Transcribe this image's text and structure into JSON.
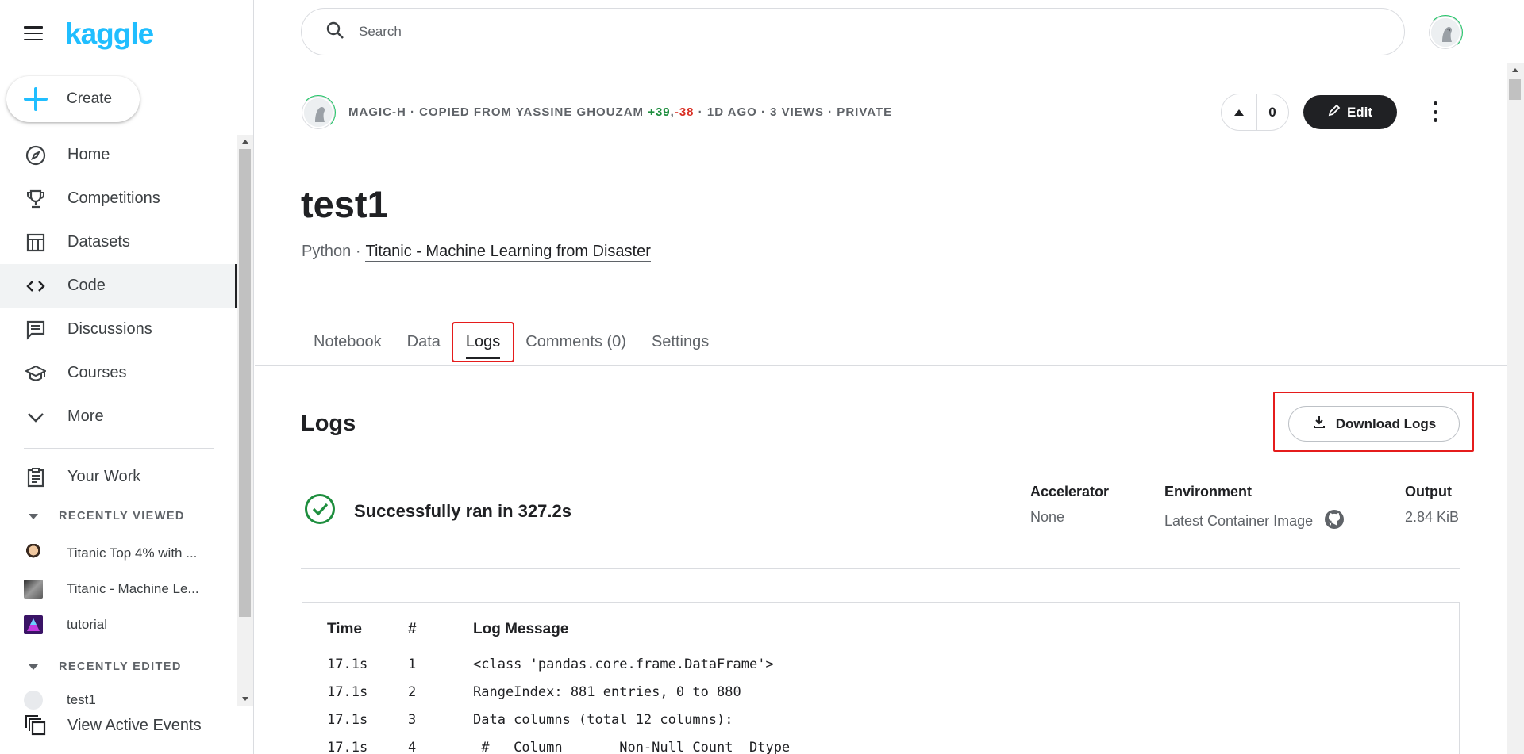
{
  "brand": {
    "logo_text": "kaggle",
    "accent": "#20beff"
  },
  "sidebar": {
    "create_label": "Create",
    "nav": [
      {
        "label": "Home",
        "icon": "compass-icon"
      },
      {
        "label": "Competitions",
        "icon": "trophy-icon"
      },
      {
        "label": "Datasets",
        "icon": "table-icon"
      },
      {
        "label": "Code",
        "icon": "code-icon",
        "active": true
      },
      {
        "label": "Discussions",
        "icon": "comments-icon"
      },
      {
        "label": "Courses",
        "icon": "school-icon"
      },
      {
        "label": "More",
        "icon": "chevron-down-icon"
      }
    ],
    "your_work": "Your Work",
    "recently_viewed_title": "RECENTLY VIEWED",
    "recently_viewed": [
      {
        "label": "Titanic Top 4% with ..."
      },
      {
        "label": "Titanic - Machine Le..."
      },
      {
        "label": "tutorial"
      }
    ],
    "recently_edited_title": "RECENTLY EDITED",
    "recently_edited": [
      {
        "label": "test1"
      }
    ],
    "view_active_events": "View Active Events"
  },
  "search": {
    "placeholder": "Search"
  },
  "notebook": {
    "meta": {
      "author": "MAGIC-H",
      "copied_from": " · COPIED FROM YASSINE GHOUZAM ",
      "plus": "+39",
      "comma": ",",
      "minus": "-38",
      "rest": " · 1D AGO · 3 VIEWS · PRIVATE"
    },
    "vote_count": "0",
    "edit_label": "Edit",
    "title": "test1",
    "language": "Python ·",
    "competition": "Titanic - Machine Learning from Disaster",
    "tabs": [
      "Notebook",
      "Data",
      "Logs",
      "Comments (0)",
      "Settings"
    ],
    "active_tab": "Logs"
  },
  "logs": {
    "title": "Logs",
    "download_label": "Download Logs",
    "status": "Successfully ran in 327.2s",
    "status_color": "#1e8e3e",
    "accelerator_label": "Accelerator",
    "accelerator_value": "None",
    "environment_label": "Environment",
    "environment_value": "Latest Container Image",
    "output_label": "Output",
    "output_value": "2.84 KiB",
    "columns": [
      "Time",
      "#",
      "Log Message"
    ],
    "rows": [
      {
        "time": "17.1s",
        "num": "1",
        "msg": "<class 'pandas.core.frame.DataFrame'>"
      },
      {
        "time": "17.1s",
        "num": "2",
        "msg": "RangeIndex: 881 entries, 0 to 880"
      },
      {
        "time": "17.1s",
        "num": "3",
        "msg": "Data columns (total 12 columns):"
      },
      {
        "time": "17.1s",
        "num": "4",
        "msg": " #   Column       Non-Null Count  Dtype"
      }
    ]
  }
}
